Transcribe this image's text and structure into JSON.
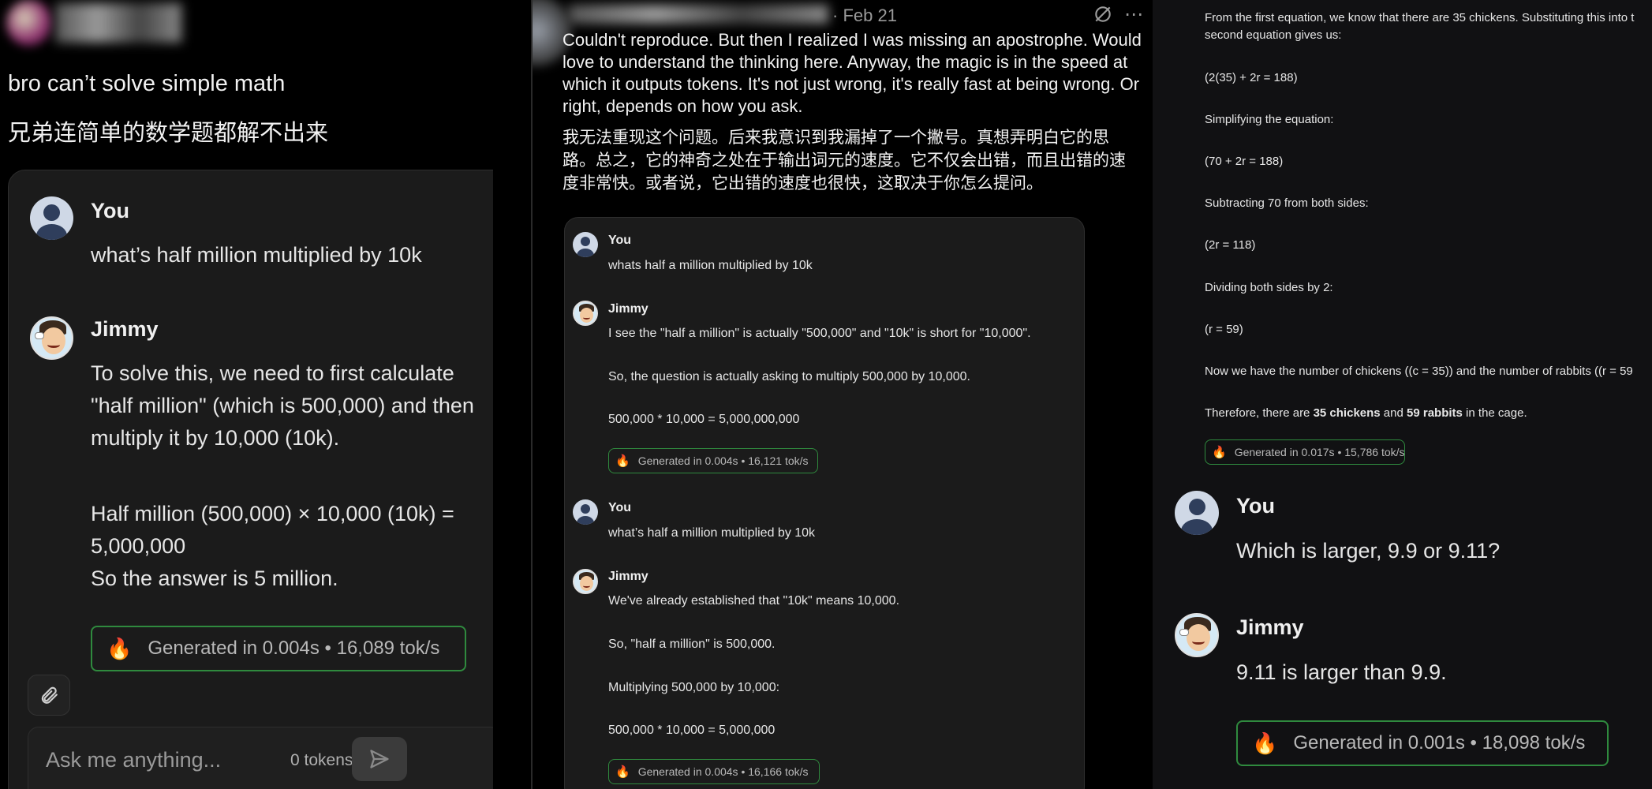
{
  "panel1": {
    "tweet_en": "bro can’t solve simple math",
    "tweet_zh": "兄弟连简单的数学题都解不出来",
    "chat": {
      "user_name": "You",
      "user_msg": "what’s half million multiplied by 10k",
      "bot_name": "Jimmy",
      "bot_lines": [
        "To solve this, we need to first calculate",
        "\"half million\" (which is 500,000) and then",
        "multiply it by 10,000 (10k).",
        "Half million (500,000) × 10,000 (10k) =",
        "5,000,000",
        "So the answer is 5 million."
      ],
      "badge": "Generated in 0.004s • 16,089 tok/s",
      "input_placeholder": "Ask me anything...",
      "token_count": "0 tokens"
    }
  },
  "panel3": {
    "header_date": "· Feb 21",
    "tweet_en": [
      "Couldn't reproduce. But then I realized I was missing an apostrophe. Would",
      "love to understand the thinking here. Anyway, the magic is in the speed at",
      "which it outputs tokens. It's not just wrong, it's really fast at being wrong. Or",
      "right, depends on how you ask."
    ],
    "tweet_zh": [
      "我无法重现这个问题。后来我意识到我漏掉了一个撇号。真想弄明白它的思",
      "路。总之，它的神奇之处在于输出词元的速度。它不仅会出错，而且出错的速",
      "度非常快。或者说，它出错的速度也很快，这取决于你怎么提问。"
    ],
    "chat": [
      {
        "sender": "You",
        "lines": [
          "whats half a million multiplied by 10k"
        ]
      },
      {
        "sender": "Jimmy",
        "lines": [
          "I see the \"half a million\" is actually \"500,000\" and \"10k\" is short for \"10,000\".",
          "So, the question is actually asking to multiply 500,000 by 10,000.",
          "500,000 * 10,000 = 5,000,000,000"
        ],
        "badge": "Generated in 0.004s • 16,121 tok/s"
      },
      {
        "sender": "You",
        "lines": [
          "what’s half a million multiplied by 10k"
        ]
      },
      {
        "sender": "Jimmy",
        "lines": [
          "We've already established that \"10k\" means 10,000.",
          "So, \"half a million\" is 500,000.",
          "Multiplying 500,000 by 10,000:",
          "500,000 * 10,000 = 5,000,000"
        ],
        "badge": "Generated in 0.004s • 16,166 tok/s"
      }
    ]
  },
  "panel4": {
    "lines": [
      "From the first equation, we know that there are 35 chickens. Substituting this into t",
      "second equation gives us:",
      "(2(35) + 2r = 188)",
      "Simplifying the equation:",
      "(70 + 2r = 188)",
      "Subtracting 70 from both sides:",
      "(2r = 118)",
      "Dividing both sides by 2:",
      "(r = 59)",
      "Now we have the number of chickens ((c = 35)) and the number of rabbits ((r = 59"
    ],
    "conclusion_prefix": "Therefore, there are ",
    "conclusion_chickens": "35 chickens",
    "conclusion_and": " and ",
    "conclusion_rabbits": "59 rabbits",
    "conclusion_suffix": " in the cage.",
    "badge_small": "Generated in 0.017s • 15,786 tok/s",
    "user_name": "You",
    "user_msg": "Which is larger, 9.9 or 9.11?",
    "bot_name": "Jimmy",
    "bot_msg": "9.11 is larger than 9.9.",
    "badge_large": "Generated in 0.001s • 18,098 tok/s"
  },
  "colors": {
    "badge_border": "#2f8a3e",
    "fire": "#ff6a1a",
    "card_bg": "#1b1b1b"
  }
}
